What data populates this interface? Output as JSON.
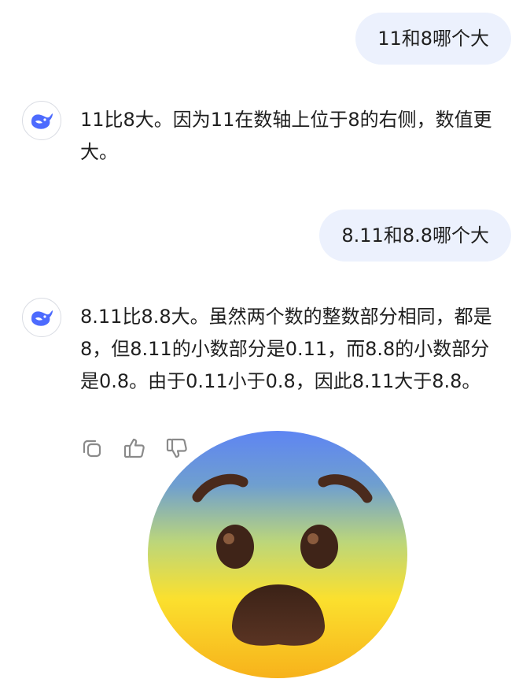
{
  "conversation": {
    "messages": [
      {
        "role": "user",
        "text": "11和8哪个大"
      },
      {
        "role": "assistant",
        "text": "11比8大。因为11在数轴上位于8的右侧，数值更大。"
      },
      {
        "role": "user",
        "text": "8.11和8.8哪个大"
      },
      {
        "role": "assistant",
        "text": "8.11比8.8大。虽然两个数的整数部分相同，都是8，但8.11的小数部分是0.11，而8.8的小数部分是0.8。由于0.11小于0.8，因此8.11大于8.8。"
      }
    ]
  },
  "icons": {
    "avatar": "whale-logo-icon",
    "copy": "copy-icon",
    "like": "thumbs-up-icon",
    "dislike": "thumbs-down-icon",
    "overlay": "fearful-face-emoji"
  },
  "colors": {
    "user_bubble": "#ecf1fd",
    "brand": "#4d6bfe",
    "text": "#1f1f1f",
    "icon_gray": "#8a8a8a"
  }
}
